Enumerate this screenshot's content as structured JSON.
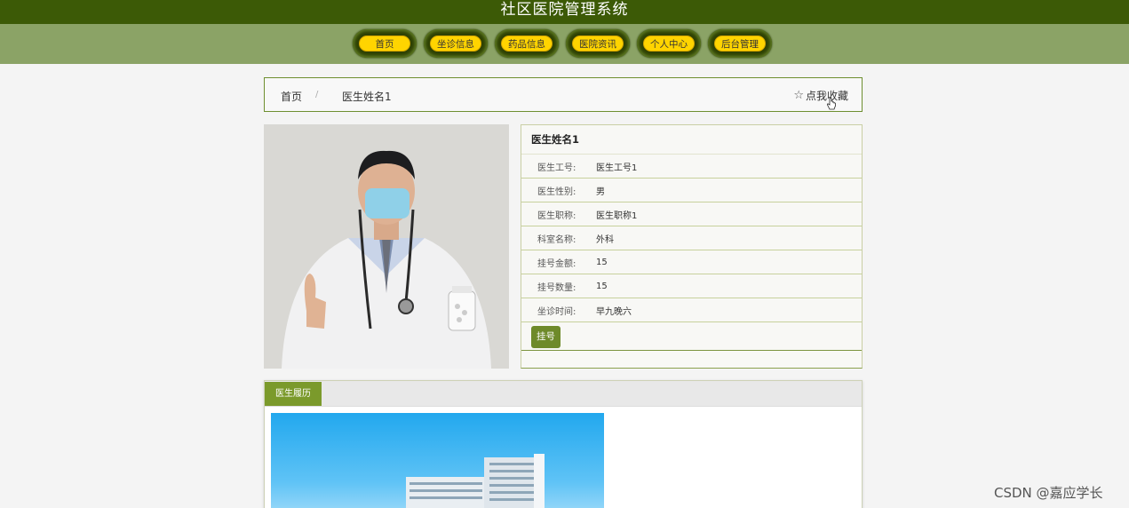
{
  "header": {
    "title": "社区医院管理系统"
  },
  "nav": [
    {
      "label": "首页"
    },
    {
      "label": "坐诊信息"
    },
    {
      "label": "药品信息"
    },
    {
      "label": "医院资讯"
    },
    {
      "label": "个人中心"
    },
    {
      "label": "后台管理"
    }
  ],
  "breadcrumb": {
    "home": "首页",
    "sep": "/",
    "current": "医生姓名1",
    "favorite": "点我收藏"
  },
  "doctor": {
    "name": "医生姓名1",
    "fields": [
      {
        "label": "医生工号:",
        "value": "医生工号1"
      },
      {
        "label": "医生性别:",
        "value": "男"
      },
      {
        "label": "医生职称:",
        "value": "医生职称1"
      },
      {
        "label": "科室名称:",
        "value": "外科"
      },
      {
        "label": "挂号金额:",
        "value": "15"
      },
      {
        "label": "挂号数量:",
        "value": "15"
      },
      {
        "label": "坐诊时间:",
        "value": "早九晚六"
      }
    ],
    "register_label": "挂号"
  },
  "tabs": {
    "active": "医生履历"
  },
  "watermark": "CSDN @嘉应学长",
  "colors": {
    "header": "#3c5a06",
    "navband": "#8ba366",
    "nav_pill": "#ffd400",
    "accent": "#6e8a2a"
  }
}
